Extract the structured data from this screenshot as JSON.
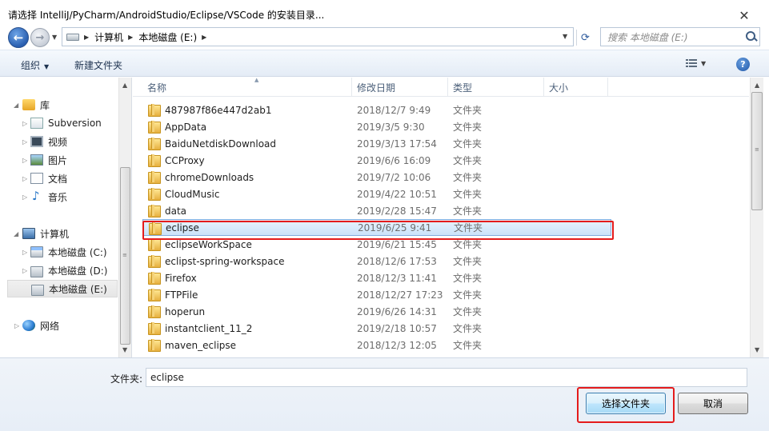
{
  "window": {
    "title": "请选择 IntelliJ/PyCharm/AndroidStudio/Eclipse/VSCode 的安装目录...",
    "close_glyph": "✕"
  },
  "address_bar": {
    "crumbs": [
      "计算机",
      "本地磁盘 (E:)"
    ]
  },
  "search": {
    "placeholder": "搜索 本地磁盘 (E:)"
  },
  "toolbar": {
    "organize_label": "组织",
    "new_folder_label": "新建文件夹"
  },
  "nav": {
    "libraries_label": "库",
    "items": [
      {
        "label": "Subversion",
        "icon": "subversion-icon"
      },
      {
        "label": "视频",
        "icon": "video-icon"
      },
      {
        "label": "图片",
        "icon": "picture-icon"
      },
      {
        "label": "文档",
        "icon": "document-icon"
      },
      {
        "label": "音乐",
        "icon": "music-icon"
      }
    ],
    "computer_label": "计算机",
    "drives": [
      {
        "label": "本地磁盘 (C:)"
      },
      {
        "label": "本地磁盘 (D:)"
      },
      {
        "label": "本地磁盘 (E:)"
      }
    ],
    "network_label": "网络"
  },
  "columns": {
    "name": "名称",
    "date": "修改日期",
    "type": "类型",
    "size": "大小"
  },
  "files": [
    {
      "name": "487987f86e447d2ab1",
      "date": "2018/12/7 9:49",
      "type": "文件夹"
    },
    {
      "name": "AppData",
      "date": "2019/3/5 9:30",
      "type": "文件夹"
    },
    {
      "name": "BaiduNetdiskDownload",
      "date": "2019/3/13 17:54",
      "type": "文件夹"
    },
    {
      "name": "CCProxy",
      "date": "2019/6/6 16:09",
      "type": "文件夹"
    },
    {
      "name": "chromeDownloads",
      "date": "2019/7/2 10:06",
      "type": "文件夹"
    },
    {
      "name": "CloudMusic",
      "date": "2019/4/22 10:51",
      "type": "文件夹"
    },
    {
      "name": "data",
      "date": "2019/2/28 15:47",
      "type": "文件夹"
    },
    {
      "name": "eclipse",
      "date": "2019/6/25 9:41",
      "type": "文件夹"
    },
    {
      "name": "eclipseWorkSpace",
      "date": "2019/6/21 15:45",
      "type": "文件夹"
    },
    {
      "name": "eclipst-spring-workspace",
      "date": "2018/12/6 17:53",
      "type": "文件夹"
    },
    {
      "name": "Firefox",
      "date": "2018/12/3 11:41",
      "type": "文件夹"
    },
    {
      "name": "FTPFile",
      "date": "2018/12/27 17:23",
      "type": "文件夹"
    },
    {
      "name": "hoperun",
      "date": "2019/6/26 14:31",
      "type": "文件夹"
    },
    {
      "name": "instantclient_11_2",
      "date": "2019/2/18 10:57",
      "type": "文件夹"
    },
    {
      "name": "maven_eclipse",
      "date": "2018/12/3 12:05",
      "type": "文件夹"
    }
  ],
  "selected_file": "eclipse",
  "footer": {
    "folder_label": "文件夹:",
    "folder_value": "eclipse",
    "select_button": "选择文件夹",
    "cancel_button": "取消"
  },
  "colors": {
    "highlight_red": "#e41c1c",
    "selection_blue": "#cbe3fa"
  }
}
